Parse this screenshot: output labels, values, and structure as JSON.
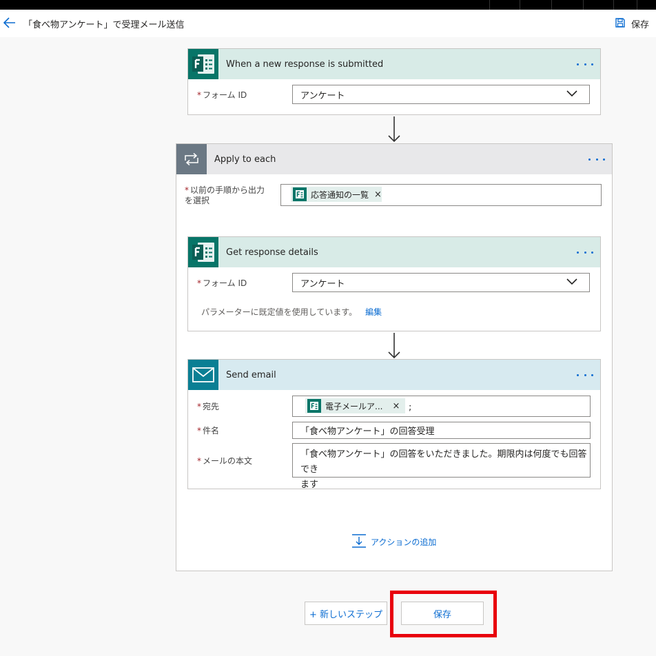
{
  "header": {
    "title": "「食べ物アンケート」で受理メール送信",
    "save_label": "保存"
  },
  "trigger": {
    "title": "When a new response is submitted",
    "form_id_label": "フォーム ID",
    "form_id_value": "アンケート"
  },
  "loop": {
    "title": "Apply to each",
    "select_label_line1": "以前の手順から出力",
    "select_label_line2": "を選択",
    "token_label": "応答通知の一覧"
  },
  "get_details": {
    "title": "Get response details",
    "form_id_label": "フォーム ID",
    "form_id_value": "アンケート",
    "helper_text": "パラメーターに既定値を使用しています。",
    "edit_label": "編集"
  },
  "send_email": {
    "title": "Send email",
    "to_label": "宛先",
    "to_token": "電子メールア...",
    "to_suffix": ";",
    "subject_label": "件名",
    "subject_value": "「食べ物アンケート」の回答受理",
    "body_label": "メールの本文",
    "body_line1": "「食べ物アンケート」の回答をいただきました。期限内は何度でも回答でき",
    "body_line2": "ます"
  },
  "add_action_label": "アクションの追加",
  "footer": {
    "new_step_label": "+ 新しいステップ",
    "save_label": "保存"
  },
  "colors": {
    "forms_tile": "#077568",
    "email_tile": "#0a7f94",
    "loop_tile": "#6b7884",
    "link": "#0b6cd1",
    "highlight": "#e8000b"
  },
  "icons": [
    "back-arrow-icon",
    "save-disk-icon",
    "forms-icon",
    "loop-icon",
    "mail-icon",
    "chevron-down-icon",
    "more-icon",
    "add-action-icon",
    "close-icon",
    "arrow-down-icon"
  ]
}
